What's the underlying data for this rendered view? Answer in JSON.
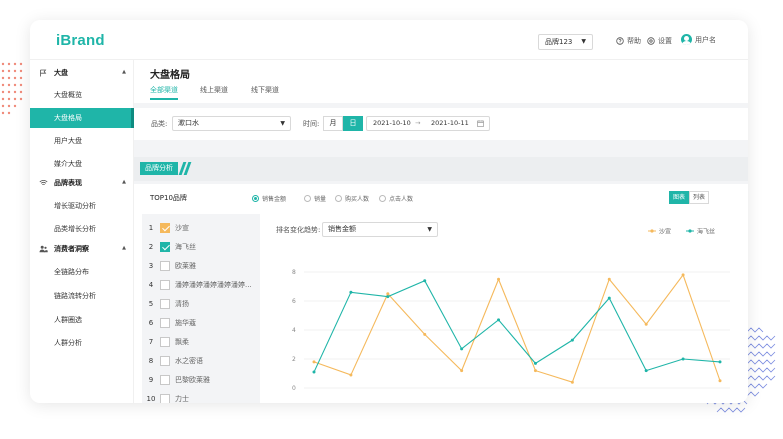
{
  "app": {
    "logo": "iBrand"
  },
  "topbar": {
    "brand_select": "品牌123",
    "help": "帮助",
    "settings": "设置",
    "user": "用户名"
  },
  "sidebar": {
    "groups": [
      {
        "label": "大盘",
        "icon": "flag-icon",
        "items": [
          "大盘概览",
          "大盘格局",
          "用户大盘",
          "媒介大盘"
        ]
      },
      {
        "label": "品牌表现",
        "icon": "wifi-icon",
        "items": [
          "增长驱动分析",
          "品类增长分析"
        ]
      },
      {
        "label": "消费者洞察",
        "icon": "users-icon",
        "items": [
          "全链路分布",
          "链路流转分析",
          "人群圈选",
          "人群分析"
        ]
      }
    ],
    "active_item": "大盘格局"
  },
  "page": {
    "title": "大盘格局",
    "tabs": [
      "全部渠道",
      "线上渠道",
      "线下渠道"
    ],
    "active_tab": "全部渠道"
  },
  "filters": {
    "category_label": "品类:",
    "category_value": "漱口水",
    "time_label": "时间:",
    "month": "月",
    "day": "日",
    "date_start": "2021-10-10",
    "date_sep": "→",
    "date_end": "2021-10-11"
  },
  "section": {
    "tag": "品牌分析"
  },
  "panel": {
    "title": "TOP10品牌",
    "metrics": [
      "销售金额",
      "销量",
      "购买人数",
      "点击人数"
    ],
    "selected_metric": "销售金额",
    "view_chart": "图表",
    "view_list": "列表",
    "trend_label": "排名变化趋势:",
    "trend_select": "销售金额"
  },
  "brands": [
    {
      "rank": "1",
      "name": "沙宣",
      "checked": true,
      "color": "orange"
    },
    {
      "rank": "2",
      "name": "海飞丝",
      "checked": true,
      "color": "teal"
    },
    {
      "rank": "3",
      "name": "欧莱雅",
      "checked": false,
      "color": ""
    },
    {
      "rank": "4",
      "name": "潘婷潘婷潘婷潘婷潘婷...",
      "checked": false,
      "color": ""
    },
    {
      "rank": "5",
      "name": "清扬",
      "checked": false,
      "color": ""
    },
    {
      "rank": "6",
      "name": "施华蔻",
      "checked": false,
      "color": ""
    },
    {
      "rank": "7",
      "name": "飘柔",
      "checked": false,
      "color": ""
    },
    {
      "rank": "8",
      "name": "水之密语",
      "checked": false,
      "color": ""
    },
    {
      "rank": "9",
      "name": "巴黎欧莱雅",
      "checked": false,
      "color": ""
    },
    {
      "rank": "10",
      "name": "力士",
      "checked": false,
      "color": ""
    }
  ],
  "colors": {
    "accent": "#1fb5a8",
    "orange": "#f5b95c"
  },
  "chart_data": {
    "type": "line",
    "x": [
      1,
      2,
      3,
      4,
      5,
      6,
      7,
      8,
      9,
      10,
      11,
      12,
      13
    ],
    "ylim": [
      0,
      8
    ],
    "yticks": [
      "0",
      "2",
      "4",
      "6",
      "8"
    ],
    "legend_position": "top-right",
    "grid": true,
    "series": [
      {
        "name": "沙宣",
        "color": "#f5b95c",
        "values": [
          1.8,
          0.9,
          6.5,
          3.7,
          1.2,
          7.5,
          1.2,
          0.4,
          7.5,
          4.4,
          7.8,
          0.5
        ]
      },
      {
        "name": "海飞丝",
        "color": "#1fb5a8",
        "values": [
          1.1,
          6.6,
          6.3,
          7.4,
          2.7,
          4.7,
          1.7,
          3.3,
          6.2,
          1.2,
          2.0,
          1.8
        ]
      }
    ]
  }
}
